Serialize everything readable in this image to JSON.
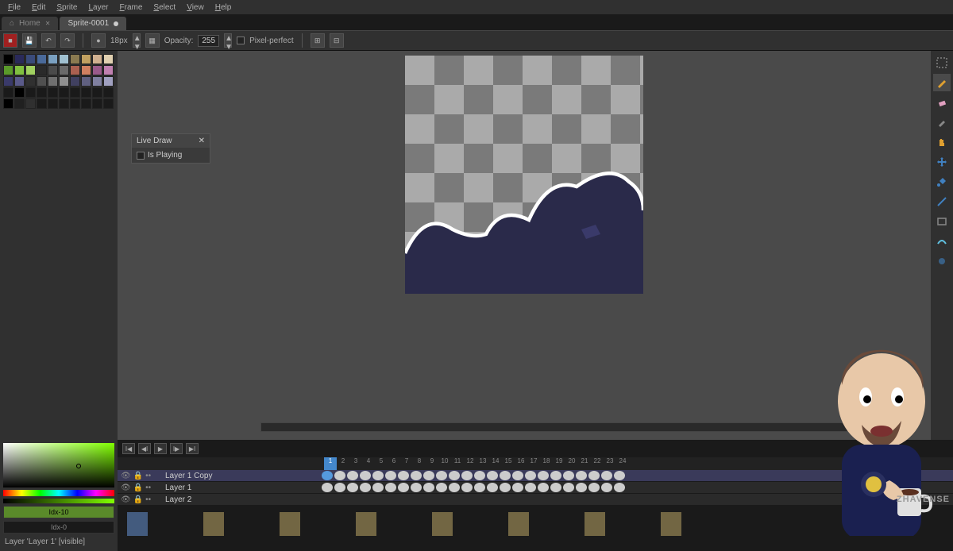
{
  "menu": [
    "File",
    "Edit",
    "Sprite",
    "Layer",
    "Frame",
    "Select",
    "View",
    "Help"
  ],
  "tabs": [
    {
      "label": "Home",
      "active": false,
      "icon": "⌂"
    },
    {
      "label": "Sprite-0001",
      "active": true,
      "dirty": true
    }
  ],
  "toolbar": {
    "brush_size": "18px",
    "opacity_label": "Opacity:",
    "opacity": "255",
    "pixel_perfect": "Pixel-perfect"
  },
  "live_draw": {
    "title": "Live Draw",
    "option": "Is Playing"
  },
  "palette_colors": [
    "#000000",
    "#2a2a5a",
    "#3a4b7a",
    "#4a6a9a",
    "#7aa0c0",
    "#a0c0d0",
    "#8a7a50",
    "#c0a060",
    "#d0b090",
    "#e0d0b0",
    "#5a9a2a",
    "#80c040",
    "#a0d060",
    "#2a2a2a",
    "#4a4a4a",
    "#6a6a6a",
    "#aa6050",
    "#d08060",
    "#9a5a8a",
    "#c080b0",
    "#3a3a6a",
    "#5a5a8a",
    "#303030",
    "#505050",
    "#707070",
    "#909090",
    "#404060",
    "#606080",
    "#8080a0",
    "#a0a0c0",
    "#1a1a1a",
    "#000000",
    "#1a1a1a",
    "#1a1a1a",
    "#1a1a1a",
    "#1a1a1a",
    "#1a1a1a",
    "#1a1a1a",
    "#1a1a1a",
    "#1a1a1a",
    "#000000",
    "#202020",
    "#303030",
    "#1a1a1a",
    "#1a1a1a",
    "#1a1a1a",
    "#1a1a1a",
    "#1a1a1a",
    "#1a1a1a",
    "#1a1a1a"
  ],
  "tools": [
    "select",
    "pencil",
    "eraser",
    "eyedropper",
    "hand",
    "move",
    "fill",
    "line",
    "rect",
    "contour",
    "blur"
  ],
  "timeline": {
    "frame_count": 24,
    "active_frame": 1,
    "layers": [
      {
        "name": "Layer 1 Copy",
        "active": true,
        "cels_in": [
          1
        ]
      },
      {
        "name": "Layer 1",
        "active": false,
        "cels_in": []
      },
      {
        "name": "Layer 2",
        "active": false,
        "cels_in": []
      }
    ]
  },
  "color_idx": {
    "fg": "Idx-10",
    "bg": "Idx-0"
  },
  "status_text": "Layer 'Layer 1' [visible]",
  "watermark": "ZHAVENSE"
}
